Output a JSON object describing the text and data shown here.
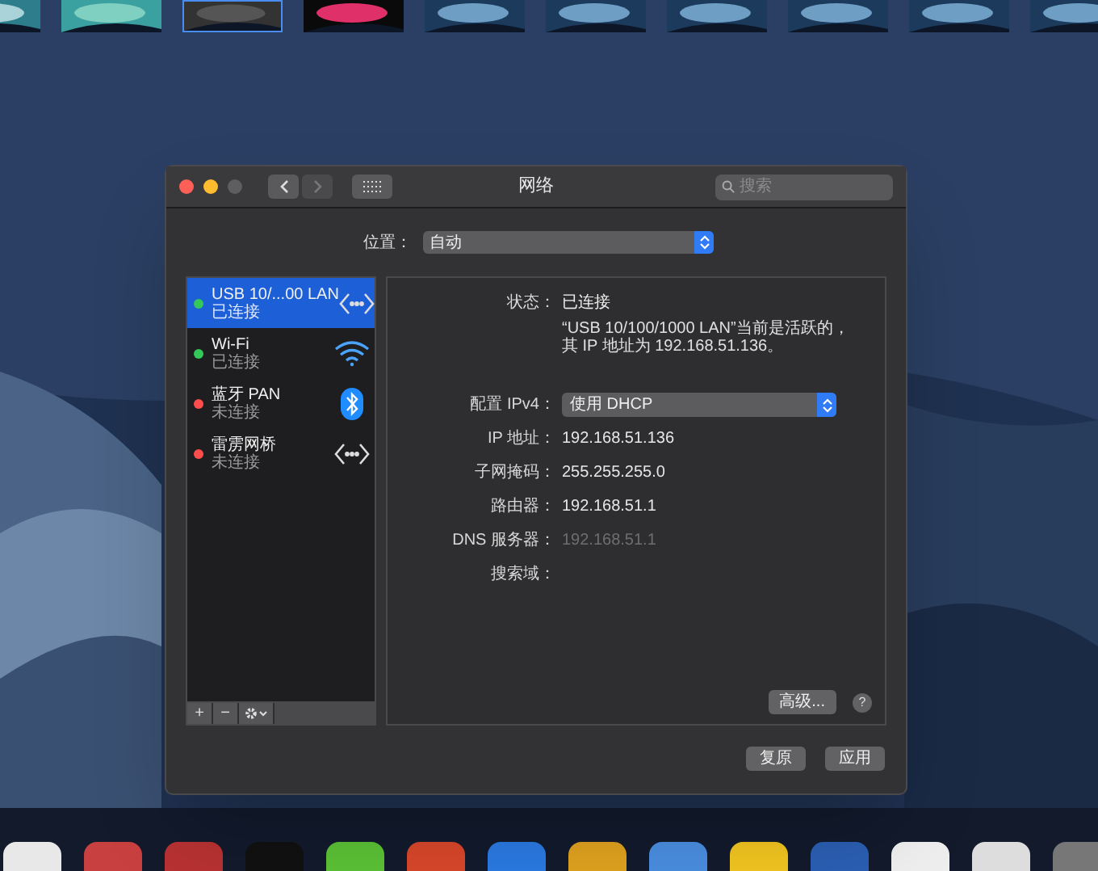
{
  "thumbnails": [
    {
      "selected": false
    },
    {
      "selected": false
    },
    {
      "selected": true
    },
    {
      "selected": false
    },
    {
      "selected": false
    },
    {
      "selected": false
    },
    {
      "selected": false
    },
    {
      "selected": false
    },
    {
      "selected": false
    },
    {
      "selected": false
    }
  ],
  "window": {
    "title": "网络",
    "search": {
      "placeholder": "搜索"
    }
  },
  "location": {
    "label": "位置：",
    "value": "自动"
  },
  "services": [
    {
      "name": "USB 10/...00 LAN",
      "status": "已连接",
      "color": "#34c759",
      "kind": "ethernet",
      "selected": true
    },
    {
      "name": "Wi-Fi",
      "status": "已连接",
      "color": "#34c759",
      "kind": "wifi",
      "selected": false
    },
    {
      "name": "蓝牙 PAN",
      "status": "未连接",
      "color": "#ff4d4d",
      "kind": "bluetooth",
      "selected": false
    },
    {
      "name": "雷雳网桥",
      "status": "未连接",
      "color": "#ff4d4d",
      "kind": "ethernet",
      "selected": false
    }
  ],
  "sidebar_tools": [
    "+",
    "−"
  ],
  "detail": {
    "status_label": "状态：",
    "status_value": "已连接",
    "description": "“USB 10/100/1000 LAN”当前是活跃的，其 IP 地址为 192.168.51.136。",
    "fields": [
      {
        "label": "配置 IPv4：",
        "value": "使用 DHCP",
        "kind": "select"
      },
      {
        "label": "IP 地址：",
        "value": "192.168.51.136",
        "kind": "text"
      },
      {
        "label": "子网掩码：",
        "value": "255.255.255.0",
        "kind": "text"
      },
      {
        "label": "路由器：",
        "value": "192.168.51.1",
        "kind": "text"
      },
      {
        "label": "DNS 服务器：",
        "value": "192.168.51.1",
        "kind": "dim"
      },
      {
        "label": "搜索域：",
        "kind": "text"
      }
    ]
  },
  "advanced_button": "高级...",
  "help_button": "?",
  "footer_buttons": [
    "复原",
    "应用"
  ]
}
